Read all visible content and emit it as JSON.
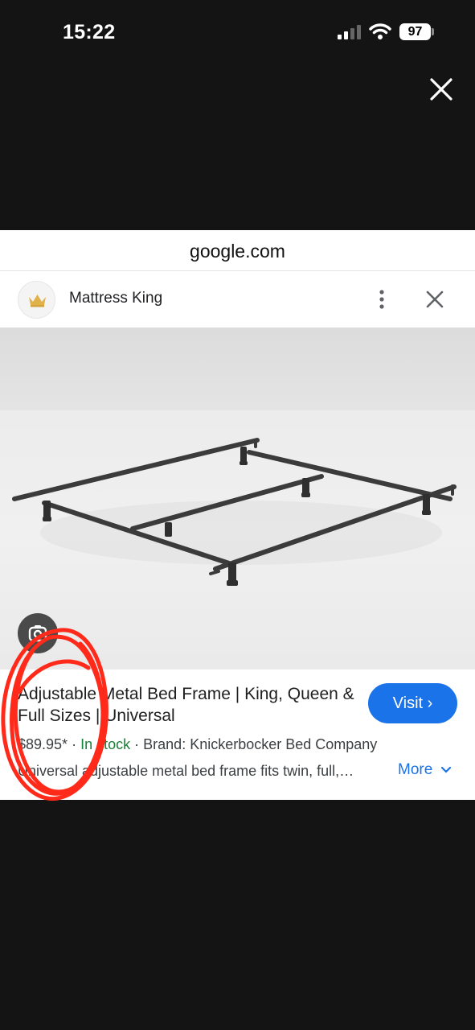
{
  "status_bar": {
    "time": "15:22",
    "battery": "97"
  },
  "viewer": {
    "domain": "google.com"
  },
  "source": {
    "name": "Mattress King"
  },
  "product": {
    "title": "Adjustable Metal Bed Frame | King, Queen & Full Sizes | Universal",
    "price": "$89.95*",
    "separator": "·",
    "stock": "In stock",
    "brand": "Brand: Knickerbocker Bed Company",
    "description": "Universal adjustable metal bed frame fits twin, full,…",
    "visit_label": "Visit ›",
    "more_label": "More"
  },
  "colors": {
    "accent": "#1a73e8",
    "stock": "#188038",
    "annotation": "#ff2a1a"
  }
}
